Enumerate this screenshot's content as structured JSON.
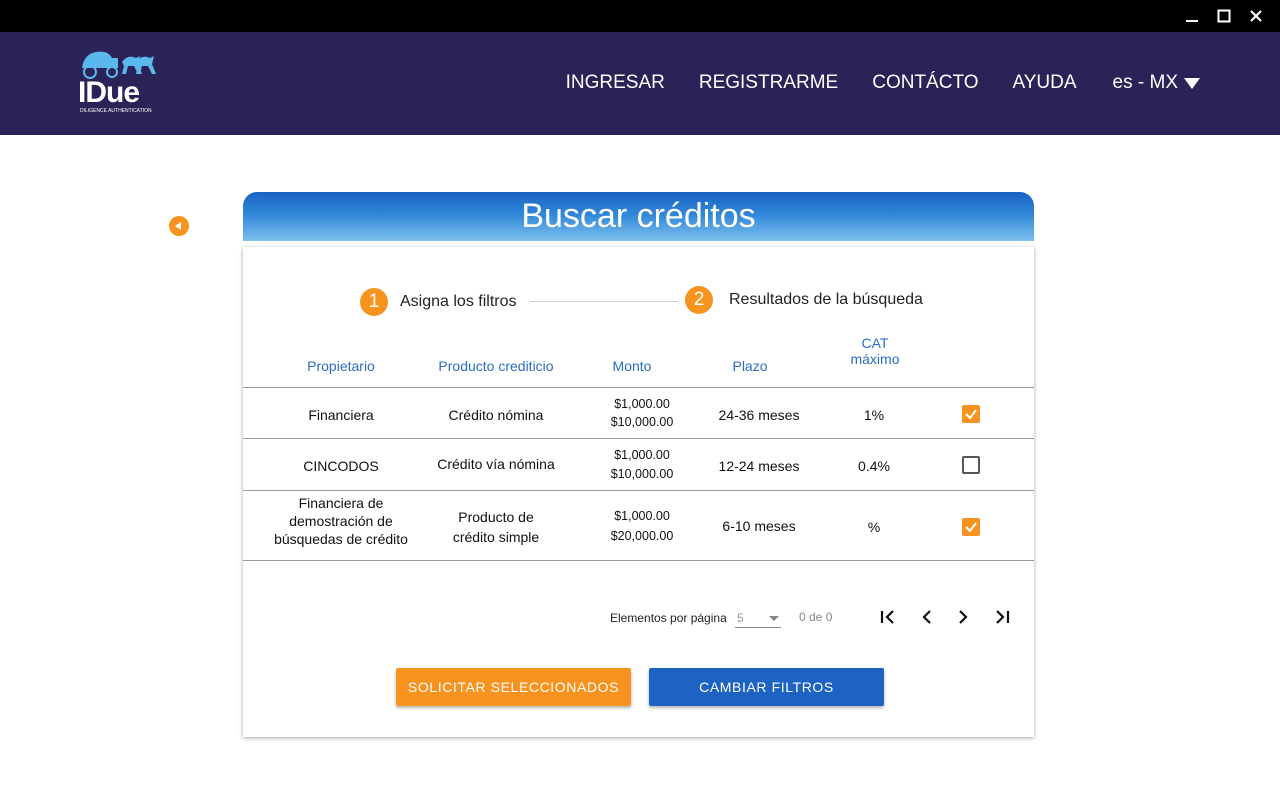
{
  "window": {
    "controls": [
      "minimize-icon",
      "maximize-icon",
      "close-icon"
    ]
  },
  "header": {
    "logo_text": "IDue",
    "logo_sub": "DILIGENCE AUTHENTICATION",
    "nav": [
      "INGRESAR",
      "REGISTRARME",
      "CONTÁCTO",
      "AYUDA"
    ],
    "language": "es - MX"
  },
  "page": {
    "title": "Buscar créditos"
  },
  "stepper": {
    "steps": [
      {
        "number": "1",
        "label": "Asigna los filtros"
      },
      {
        "number": "2",
        "label": "Resultados de la búsqueda"
      }
    ]
  },
  "table": {
    "columns": [
      "Propietario",
      "Producto crediticio",
      "Monto",
      "Plazo",
      "CAT máximo"
    ],
    "rows": [
      {
        "owner": "Financiera",
        "product": "Crédito nómina",
        "amount_min": "$1,000.00",
        "amount_max": "$10,000.00",
        "term": "24-36 meses",
        "cat": "1%",
        "selected": true
      },
      {
        "owner": "CINCODOS",
        "product": "Crédito vía nómina",
        "amount_min": "$1,000.00",
        "amount_max": "$10,000.00",
        "term": "12-24 meses",
        "cat": "0.4%",
        "selected": false
      },
      {
        "owner": "Financiera de demostración de búsquedas de crédito",
        "product": "Producto de crédito simple",
        "amount_min": "$1,000.00",
        "amount_max": "$20,000.00",
        "term": "6-10 meses",
        "cat": "%",
        "selected": true
      }
    ]
  },
  "paginator": {
    "items_per_page_label": "Elementos por página",
    "items_per_page": "5",
    "range": "0 de 0"
  },
  "actions": {
    "request_selected": "SOLICITAR SELECCIONADOS",
    "change_filters": "CAMBIAR FILTROS"
  },
  "colors": {
    "header_bg": "#2a2357",
    "accent_orange": "#f7931e",
    "accent_blue": "#1d63c4",
    "column_header": "#2b6cc4"
  }
}
